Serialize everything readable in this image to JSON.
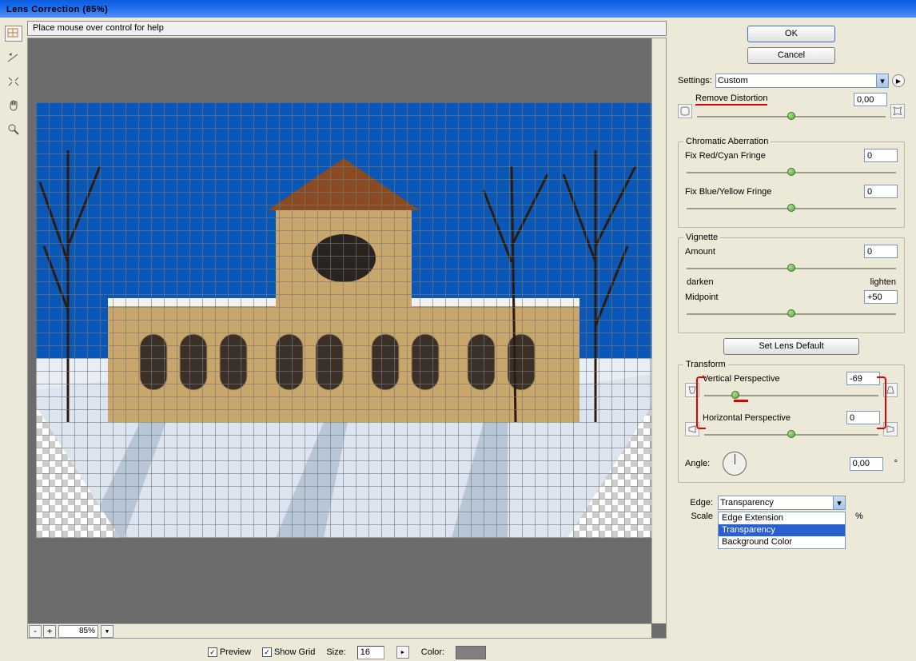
{
  "window": {
    "title": "Lens Correction (85%)"
  },
  "help": "Place mouse over control for help",
  "zoom": "85%",
  "footer": {
    "preview": "Preview",
    "showgrid": "Show Grid",
    "size_label": "Size:",
    "size": "16",
    "color_label": "Color:"
  },
  "buttons": {
    "ok": "OK",
    "cancel": "Cancel",
    "default": "Set Lens Default"
  },
  "settings": {
    "label": "Settings:",
    "value": "Custom"
  },
  "distortion": {
    "label": "Remove Distortion",
    "value": "0,00"
  },
  "chroma": {
    "group": "Chromatic Aberration",
    "red": {
      "label": "Fix Red/Cyan Fringe",
      "value": "0"
    },
    "blue": {
      "label": "Fix Blue/Yellow Fringe",
      "value": "0"
    }
  },
  "vignette": {
    "group": "Vignette",
    "amount": {
      "label": "Amount",
      "value": "0"
    },
    "darken": "darken",
    "lighten": "lighten",
    "mid": {
      "label": "Midpoint",
      "value": "+50"
    }
  },
  "transform": {
    "group": "Transform",
    "vpersp": {
      "label": "Vertical Perspective",
      "value": "-69"
    },
    "hpersp": {
      "label": "Horizontal Perspective",
      "value": "0"
    },
    "angle": {
      "label": "Angle:",
      "value": "0,00",
      "unit": "°"
    }
  },
  "edge": {
    "label": "Edge:",
    "value": "Transparency",
    "options": [
      "Edge Extension",
      "Transparency",
      "Background Color"
    ]
  },
  "scale": {
    "label": "Scale",
    "unit": "%"
  }
}
